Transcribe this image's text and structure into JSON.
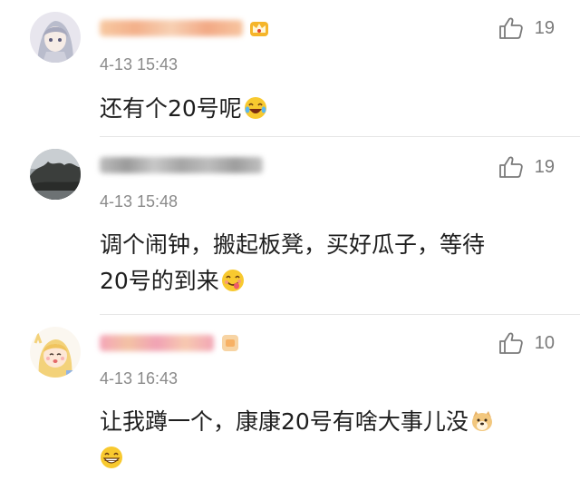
{
  "comments": [
    {
      "username": "■■■■■■■■",
      "time": "4-13 15:43",
      "text": "还有个20号呢",
      "likes": "19",
      "emoji": "laughing-tears-emoji",
      "badge": "crown-vip-icon"
    },
    {
      "username": "■■■■■■■■",
      "time": "4-13 15:48",
      "text_lines": [
        "调个闹钟，搬起板凳，买好瓜子，等待",
        "20号的到来"
      ],
      "likes": "19",
      "emoji": "yum-face-emoji"
    },
    {
      "username": "■■■■■■■■",
      "time": "4-13 16:43",
      "text_lines": [
        "让我蹲一个，康康20号有啥大事儿没"
      ],
      "likes": "10",
      "emoji": "doge-emoji",
      "emoji2": "grinning-emoji"
    }
  ]
}
